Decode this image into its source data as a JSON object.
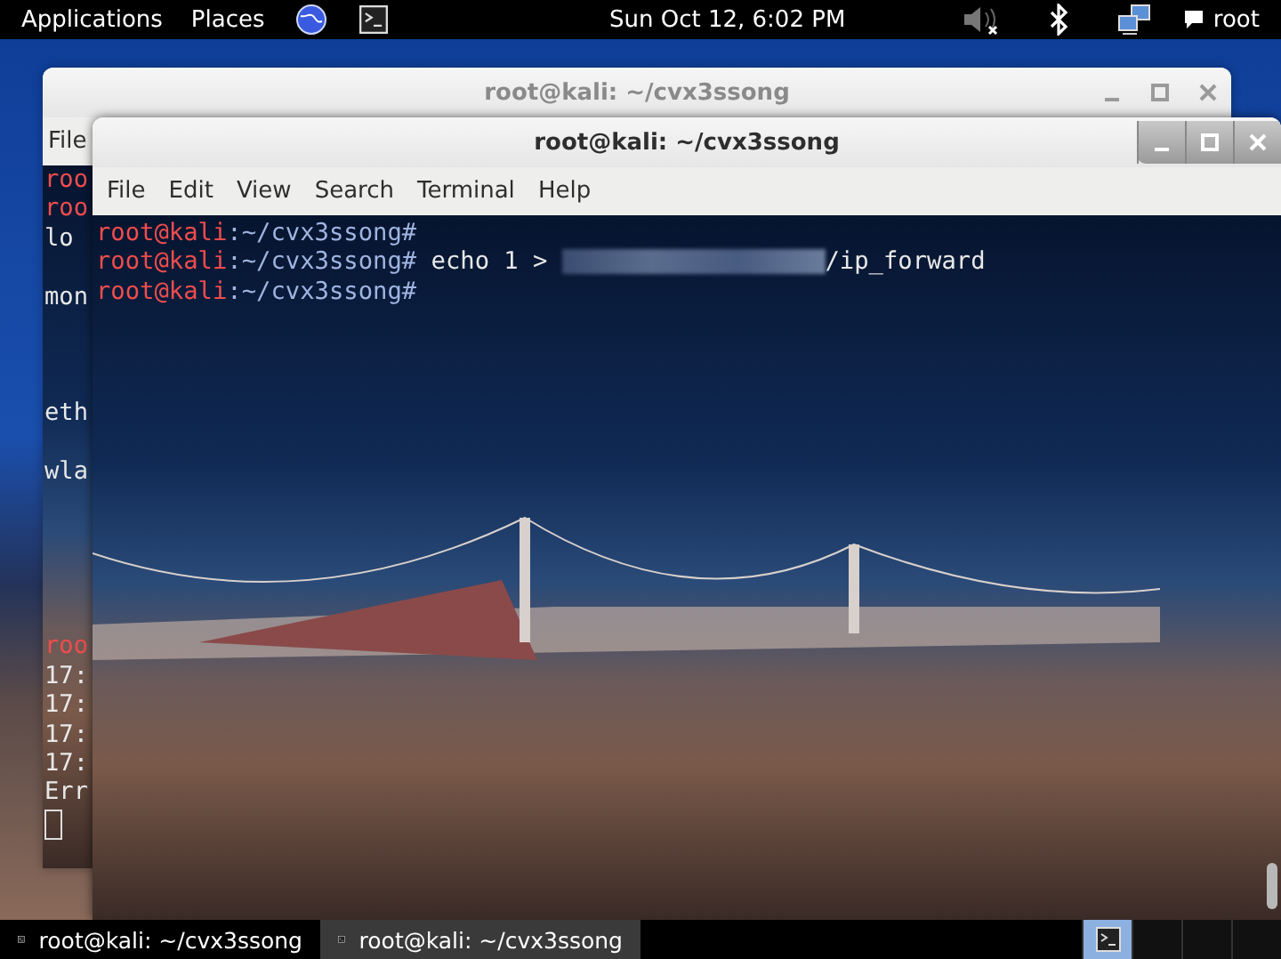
{
  "top_panel": {
    "menus": [
      "Applications",
      "Places"
    ],
    "clock": "Sun Oct 12,  6:02 PM",
    "user": "root"
  },
  "back_window": {
    "title": "root@kali: ~/cvx3ssong",
    "menu": [
      "File"
    ],
    "blocks": [
      [
        {
          "text": "roo",
          "kind": "prompt"
        },
        {
          "text": "roo",
          "kind": "prompt"
        },
        {
          "text": "lo",
          "kind": "output"
        }
      ],
      [
        {
          "text": "mon",
          "kind": "output"
        }
      ],
      [
        {
          "text": "eth",
          "kind": "output"
        }
      ],
      [
        {
          "text": "wla",
          "kind": "output"
        }
      ],
      [
        {
          "text": "roo",
          "kind": "prompt"
        },
        {
          "text": "17:",
          "kind": "output"
        },
        {
          "text": "17:",
          "kind": "output"
        },
        {
          "text": "17:",
          "kind": "output"
        },
        {
          "text": "17:",
          "kind": "output"
        },
        {
          "text": "Err",
          "kind": "output"
        }
      ]
    ]
  },
  "front_window": {
    "title": "root@kali: ~/cvx3ssong",
    "menu": [
      "File",
      "Edit",
      "View",
      "Search",
      "Terminal",
      "Help"
    ],
    "lines": [
      {
        "user": "root@kali",
        "path": ":~/cvx3ssong#",
        "redacted": false
      },
      {
        "user": "root@kali",
        "path": ":~/cvx3ssong#",
        "command": " echo 1 >",
        "redacted": true,
        "tail": "/ip_forward"
      },
      {
        "user": "root@kali",
        "path": ":~/cvx3ssong#",
        "redacted": false
      }
    ]
  },
  "taskbar": {
    "items": [
      {
        "label": "root@kali: ~/cvx3ssong",
        "selected": false
      },
      {
        "label": "root@kali: ~/cvx3ssong",
        "selected": true
      }
    ],
    "workspaces": [
      {
        "selected": true
      },
      {
        "selected": false
      },
      {
        "selected": false
      },
      {
        "selected": false
      }
    ]
  }
}
